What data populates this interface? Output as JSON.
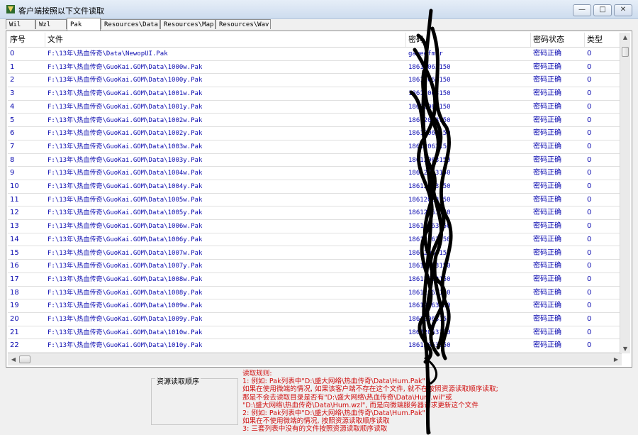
{
  "window": {
    "title": "客户端按照以下文件读取",
    "minimize_glyph": "—",
    "maximize_glyph": "□",
    "close_glyph": "✕",
    "icon": "app-icon"
  },
  "tabs": [
    {
      "label": "Wil"
    },
    {
      "label": "Wzl"
    },
    {
      "label": "Pak"
    },
    {
      "label": "Resources\\Data"
    },
    {
      "label": "Resources\\Map"
    },
    {
      "label": "Resources\\Wav"
    }
  ],
  "active_tab": "Pak",
  "table": {
    "headers": {
      "idx": "序号",
      "file": "文件",
      "password": "密码",
      "status": "密码状态",
      "type": "类型"
    },
    "rows": [
      {
        "idx": "0",
        "file": "F:\\13年\\热血传奇\\Data\\NewopUI.Pak",
        "password": "gameofmir",
        "status": "密码正确",
        "type": "0"
      },
      {
        "idx": "1",
        "file": "F:\\13年\\热血传奇\\GuoKai.GOM\\Data\\1000w.Pak",
        "password": "18612063150",
        "status": "密码正确",
        "type": "0"
      },
      {
        "idx": "2",
        "file": "F:\\13年\\热血传奇\\GuoKai.GOM\\Data\\1000y.Pak",
        "password": "18612063150",
        "status": "密码正确",
        "type": "0"
      },
      {
        "idx": "3",
        "file": "F:\\13年\\热血传奇\\GuoKai.GOM\\Data\\1001w.Pak",
        "password": "18612063150",
        "status": "密码正确",
        "type": "0"
      },
      {
        "idx": "4",
        "file": "F:\\13年\\热血传奇\\GuoKai.GOM\\Data\\1001y.Pak",
        "password": "18612063150",
        "status": "密码正确",
        "type": "0"
      },
      {
        "idx": "5",
        "file": "F:\\13年\\热血传奇\\GuoKai.GOM\\Data\\1002w.Pak",
        "password": "18612063150",
        "status": "密码正确",
        "type": "0"
      },
      {
        "idx": "6",
        "file": "F:\\13年\\热血传奇\\GuoKai.GOM\\Data\\1002y.Pak",
        "password": "18612063150",
        "status": "密码正确",
        "type": "0"
      },
      {
        "idx": "7",
        "file": "F:\\13年\\热血传奇\\GuoKai.GOM\\Data\\1003w.Pak",
        "password": "18612063150",
        "status": "密码正确",
        "type": "0"
      },
      {
        "idx": "8",
        "file": "F:\\13年\\热血传奇\\GuoKai.GOM\\Data\\1003y.Pak",
        "password": "18612063150",
        "status": "密码正确",
        "type": "0"
      },
      {
        "idx": "9",
        "file": "F:\\13年\\热血传奇\\GuoKai.GOM\\Data\\1004w.Pak",
        "password": "18612063150",
        "status": "密码正确",
        "type": "0"
      },
      {
        "idx": "10",
        "file": "F:\\13年\\热血传奇\\GuoKai.GOM\\Data\\1004y.Pak",
        "password": "18612063150",
        "status": "密码正确",
        "type": "0"
      },
      {
        "idx": "11",
        "file": "F:\\13年\\热血传奇\\GuoKai.GOM\\Data\\1005w.Pak",
        "password": "18612063150",
        "status": "密码正确",
        "type": "0"
      },
      {
        "idx": "12",
        "file": "F:\\13年\\热血传奇\\GuoKai.GOM\\Data\\1005y.Pak",
        "password": "18612063150",
        "status": "密码正确",
        "type": "0"
      },
      {
        "idx": "13",
        "file": "F:\\13年\\热血传奇\\GuoKai.GOM\\Data\\1006w.Pak",
        "password": "18612063150",
        "status": "密码正确",
        "type": "0"
      },
      {
        "idx": "14",
        "file": "F:\\13年\\热血传奇\\GuoKai.GOM\\Data\\1006y.Pak",
        "password": "18612063150",
        "status": "密码正确",
        "type": "0"
      },
      {
        "idx": "15",
        "file": "F:\\13年\\热血传奇\\GuoKai.GOM\\Data\\1007w.Pak",
        "password": "18612063150",
        "status": "密码正确",
        "type": "0"
      },
      {
        "idx": "16",
        "file": "F:\\13年\\热血传奇\\GuoKai.GOM\\Data\\1007y.Pak",
        "password": "18612063150",
        "status": "密码正确",
        "type": "0"
      },
      {
        "idx": "17",
        "file": "F:\\13年\\热血传奇\\GuoKai.GOM\\Data\\1008w.Pak",
        "password": "18612063150",
        "status": "密码正确",
        "type": "0"
      },
      {
        "idx": "18",
        "file": "F:\\13年\\热血传奇\\GuoKai.GOM\\Data\\1008y.Pak",
        "password": "18612063150",
        "status": "密码正确",
        "type": "0"
      },
      {
        "idx": "19",
        "file": "F:\\13年\\热血传奇\\GuoKai.GOM\\Data\\1009w.Pak",
        "password": "18612063150",
        "status": "密码正确",
        "type": "0"
      },
      {
        "idx": "20",
        "file": "F:\\13年\\热血传奇\\GuoKai.GOM\\Data\\1009y.Pak",
        "password": "18612063150",
        "status": "密码正确",
        "type": "0"
      },
      {
        "idx": "21",
        "file": "F:\\13年\\热血传奇\\GuoKai.GOM\\Data\\1010w.Pak",
        "password": "18612063150",
        "status": "密码正确",
        "type": "0"
      },
      {
        "idx": "22",
        "file": "F:\\13年\\热血传奇\\GuoKai.GOM\\Data\\1010y.Pak",
        "password": "18612063150",
        "status": "密码正确",
        "type": "0"
      }
    ]
  },
  "order_panel": {
    "label": "资源读取顺序"
  },
  "rules": {
    "lines": [
      "读取规则:",
      "1: 例如: Pak列表中\"D:\\盛大网络\\热血传奇\\Data\\Hum.Pak\"",
      "    如果在使用微端的情况, 如果该客户端不存在这个文件, 就不在按照资源读取顺序读取;",
      "    那是不会去读取目录是否有\"D:\\盛大网络\\热血传奇\\Data\\Hum.wil\"或",
      "    \"D:\\盛大网络\\热血传奇\\Data\\Hum.wzl\", 而是向微端服务器请求更新这个文件",
      "2: 例如: Pak列表中\"D:\\盛大网络\\热血传奇\\Data\\Hum.Pak\"",
      "    如果在不使用微端的情况, 按照资源读取顺序读取",
      "3: 三套列表中没有的文件按照资源读取顺序读取"
    ]
  },
  "colors": {
    "row_text": "#0b0bb0",
    "rules_text": "#d01010",
    "titlebar": "#cddcee"
  }
}
